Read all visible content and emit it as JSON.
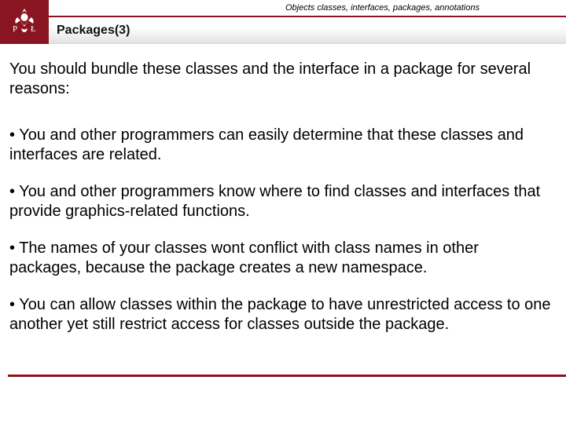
{
  "header": {
    "breadcrumb": "Objects classes, interfaces, packages, annotations",
    "title": "Packages(3)",
    "logo_letters": {
      "left": "P",
      "right": "Ł"
    }
  },
  "content": {
    "intro": "You should bundle these classes and the interface in a package for several reasons:",
    "bullets": [
      "• You and other programmers can easily determine that these classes and interfaces are related.",
      "• You and other programmers know where to find classes and interfaces that provide graphics-related functions.",
      "• The names of your classes wont conflict with class names in other packages, because the package creates a new namespace.",
      "• You can allow classes within the package to have unrestricted access to one another yet still restrict access for classes outside the package."
    ]
  },
  "colors": {
    "accent": "#8a1522"
  }
}
